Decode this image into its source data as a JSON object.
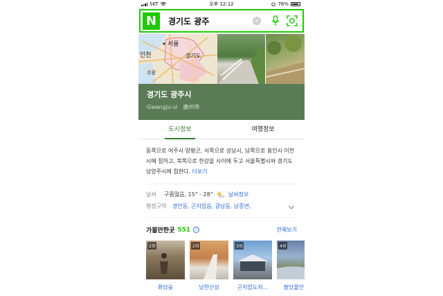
{
  "status_bar": {
    "carrier": "SKT",
    "time": "오후 12:12",
    "battery": "76%"
  },
  "search": {
    "logo": "N",
    "query": "경기도 광주"
  },
  "hero": {
    "map_labels": [
      "인천",
      "서울",
      "경기도",
      "수원"
    ],
    "title": "경기도 광주시",
    "romanized": "Gwangju-si",
    "hanja": "廣州市"
  },
  "tabs": [
    {
      "label": "도시정보",
      "active": true
    },
    {
      "label": "여행정보",
      "active": false
    }
  ],
  "description": {
    "text": "동쪽으로 여주시·양평군, 서쪽으로 성남시, 남쪽으로 용인시·이천시에 접하고, 북쪽으로 한강을 사이에 두고 서울특별시와 경기도 남양주시에 접한다.",
    "more": "더보기"
  },
  "weather": {
    "label": "날씨",
    "value": "구름많음, 15° - 28°",
    "link": "날씨정보"
  },
  "districts": {
    "label": "행정구역",
    "value": "경안동, 곤지암읍, 광남동, 남종면,"
  },
  "places": {
    "title": "가볼만한곳",
    "count": "551",
    "view_all": "전체보기",
    "items": [
      {
        "rank": "1위",
        "name": "화담숲"
      },
      {
        "rank": "2위",
        "name": "남한산성"
      },
      {
        "rank": "3위",
        "name": "곤지암도자..."
      },
      {
        "rank": "4위",
        "name": "팔당물안개"
      }
    ]
  },
  "colors": {
    "naver_green": "#1ec800",
    "hero_green": "#5a7b56",
    "link_blue": "#2d6ad8"
  }
}
